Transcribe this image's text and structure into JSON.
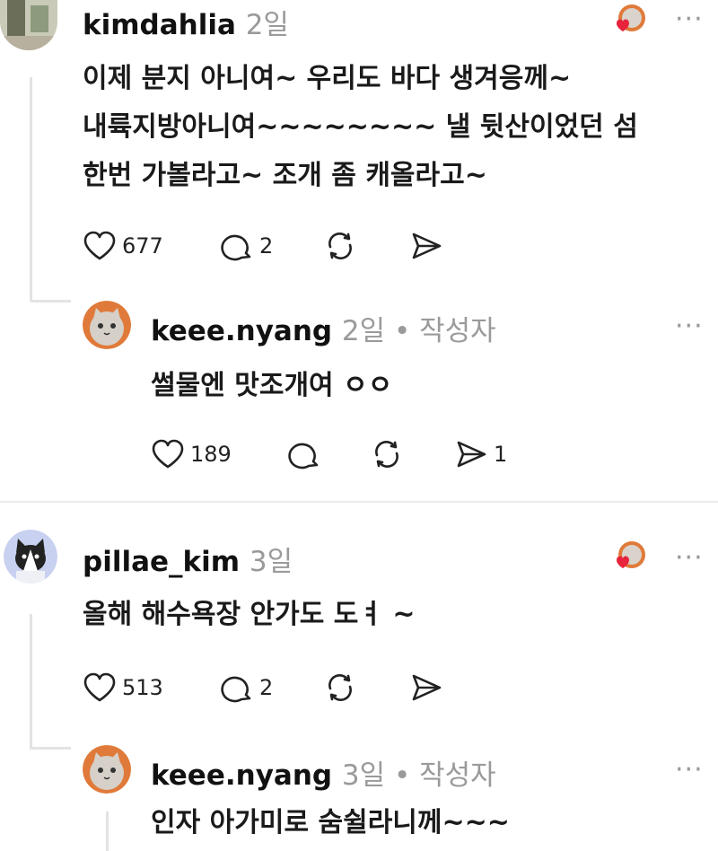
{
  "comments": [
    {
      "username": "kimdahlia",
      "time": "2일",
      "lines": [
        "이제 분지 아니여~ 우리도 바다 생겨응께~",
        "내륙지방아니여~~~~~~~~ 낼 뒷산이었던 섬",
        "한번 가볼라고~ 조개 좀 캐올라고~"
      ],
      "likes": "677",
      "replies": "2"
    },
    {
      "username": "keee.nyang",
      "time": "2일",
      "author_tag": " • 작성자",
      "lines": [
        "썰물엔 맛조개여 ㅇㅇ"
      ],
      "likes": "189",
      "shares": "1"
    },
    {
      "username": "pillae_kim",
      "time": "3일",
      "lines": [
        "올해 해수욕장 안가도 도ㅕ ~"
      ],
      "likes": "513",
      "replies": "2"
    },
    {
      "username": "keee.nyang",
      "time": "3일",
      "author_tag": " • 작성자",
      "lines": [
        "인자 아가미로 숨쉴라니께~~~"
      ]
    }
  ],
  "more_label": "···",
  "colors": {
    "heart": "#e8243c",
    "muted": "#9a9a9a",
    "divider": "#ececec"
  }
}
